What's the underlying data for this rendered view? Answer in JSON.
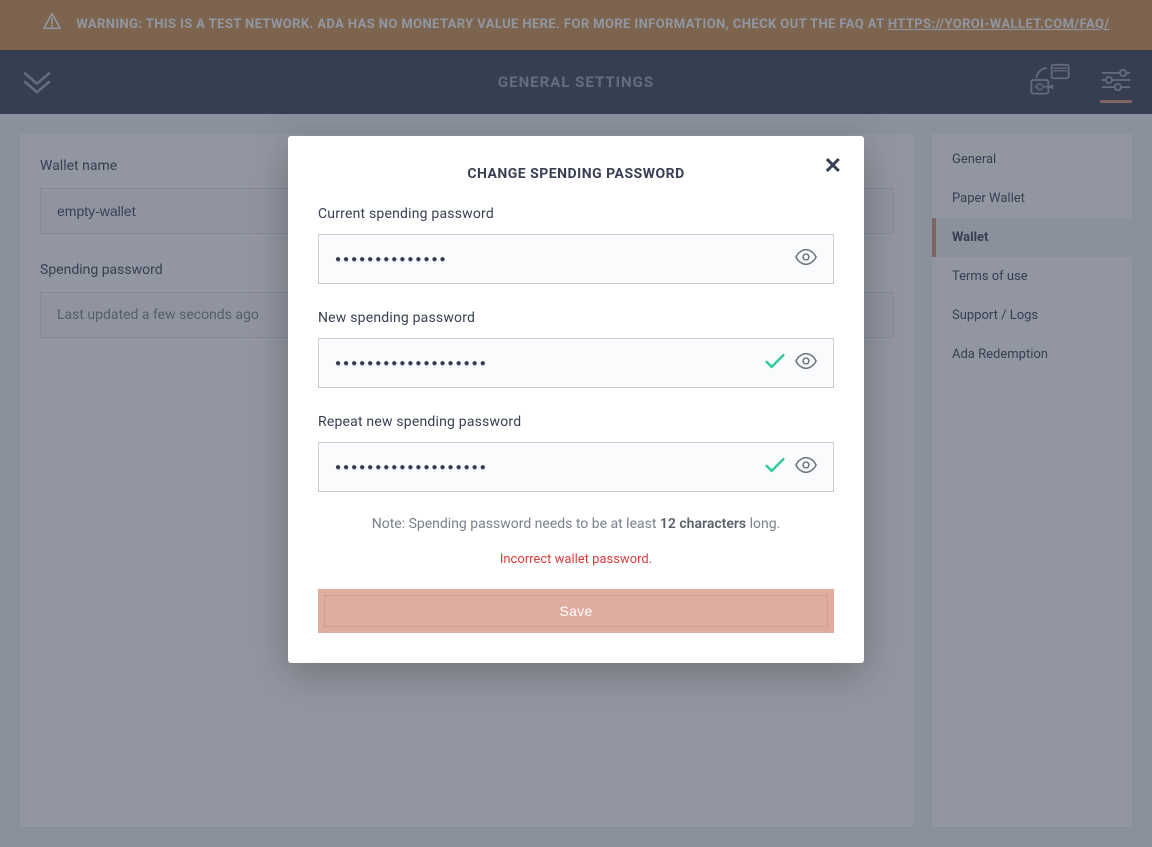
{
  "banner": {
    "text_pre": "Warning: This is a test network. ADA has no monetary value here. For more information, check out the FAQ at ",
    "link_text": "https://yoroi-wallet.com/faq/"
  },
  "topbar": {
    "title": "GENERAL SETTINGS"
  },
  "main": {
    "wallet_name_label": "Wallet name",
    "wallet_name_value": "empty-wallet",
    "spending_password_label": "Spending password",
    "spending_password_status": "Last updated a few seconds ago"
  },
  "sidebar": {
    "items": [
      {
        "label": "General",
        "active": false
      },
      {
        "label": "Paper Wallet",
        "active": false
      },
      {
        "label": "Wallet",
        "active": true
      },
      {
        "label": "Terms of use",
        "active": false
      },
      {
        "label": "Support / Logs",
        "active": false
      },
      {
        "label": "Ada Redemption",
        "active": false
      }
    ]
  },
  "modal": {
    "title": "CHANGE SPENDING PASSWORD",
    "current_label": "Current spending password",
    "new_label": "New spending password",
    "repeat_label": "Repeat new spending password",
    "current_dots": "●●●●●●●●●●●●●●",
    "new_dots": "●●●●●●●●●●●●●●●●●●●",
    "repeat_dots": "●●●●●●●●●●●●●●●●●●●",
    "note_pre": "Note: Spending password needs to be at least ",
    "note_bold": "12 characters",
    "note_post": " long.",
    "error": "Incorrect wallet password.",
    "save_label": "Save"
  }
}
